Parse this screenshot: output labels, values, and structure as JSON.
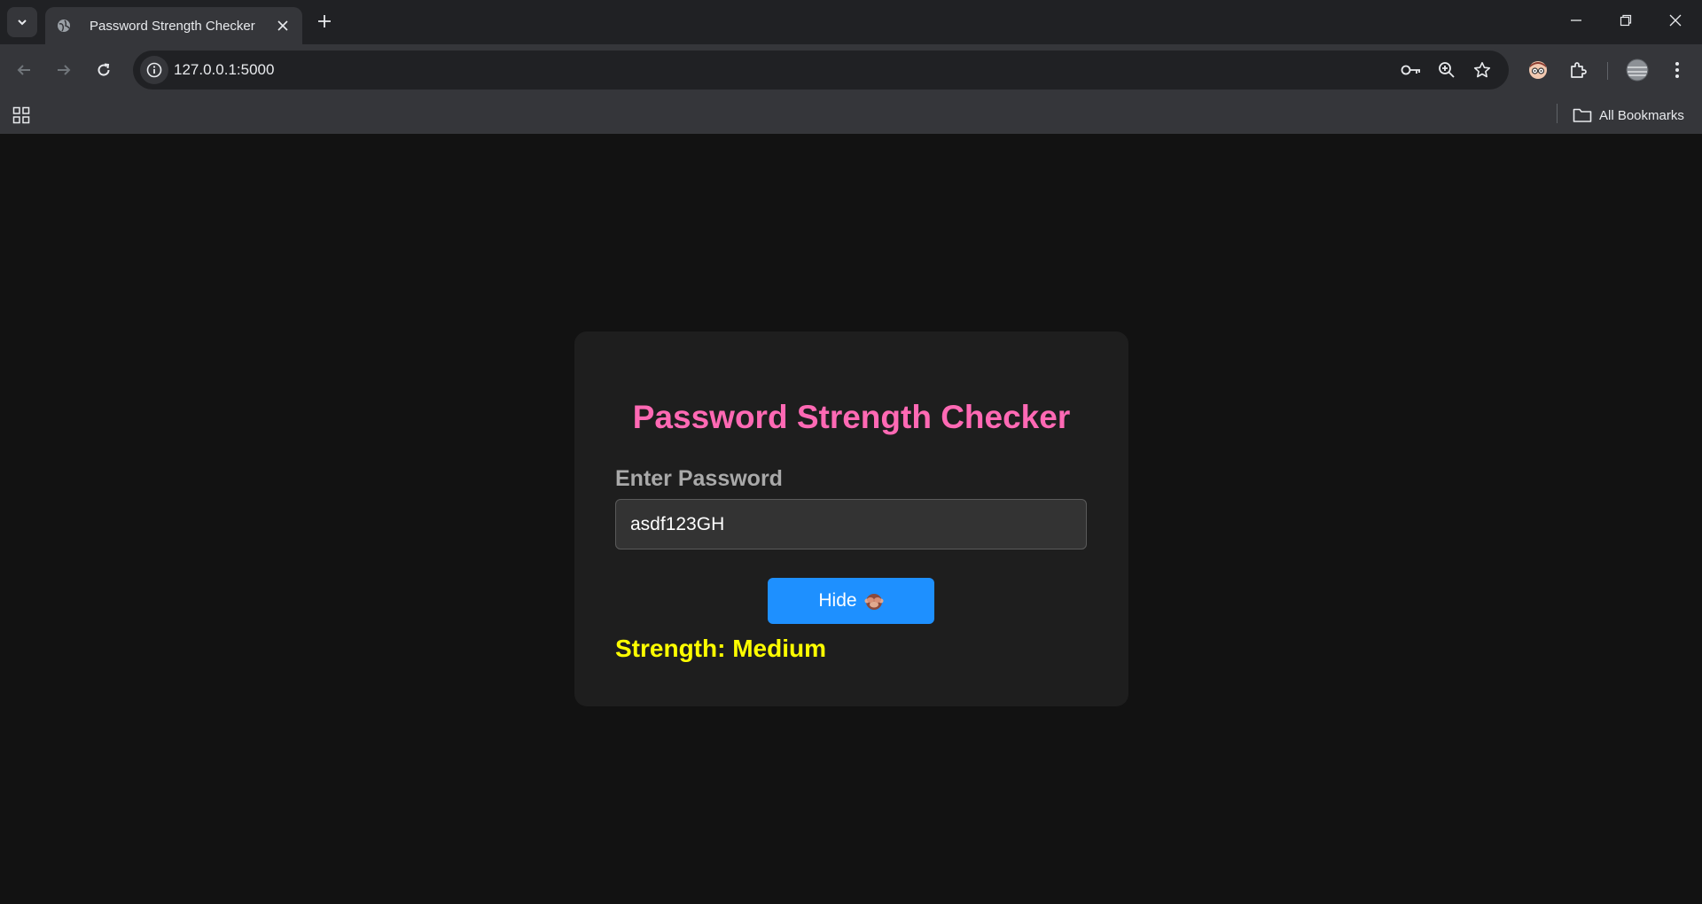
{
  "browser": {
    "tab": {
      "title": "Password Strength Checker"
    },
    "address_bar": {
      "url": "127.0.0.1:5000"
    },
    "bookmarks_bar": {
      "all_bookmarks_label": "All Bookmarks"
    }
  },
  "page": {
    "title": "Password Strength Checker",
    "password_label": "Enter Password",
    "password_value": "asdf123GH",
    "toggle_button_label": "Hide",
    "strength_text": "Strength: Medium",
    "colors": {
      "title": "#ff69b4",
      "label": "#a9a9a9",
      "button": "#1e90ff",
      "strength": "#ffff00",
      "card": "#1e1e1e",
      "background": "#121212"
    }
  },
  "icons": [
    "tab-search-icon",
    "globe-icon",
    "close-icon",
    "plus-icon",
    "minimize-icon",
    "restore-icon",
    "window-close-icon",
    "back-arrow-icon",
    "forward-arrow-icon",
    "reload-icon",
    "site-info-icon",
    "key-icon",
    "zoom-icon",
    "star-icon",
    "extension-avatar-icon",
    "puzzle-icon",
    "profile-avatar-icon",
    "kebab-menu-icon",
    "apps-grid-icon",
    "folder-icon",
    "see-no-evil-monkey-icon"
  ]
}
